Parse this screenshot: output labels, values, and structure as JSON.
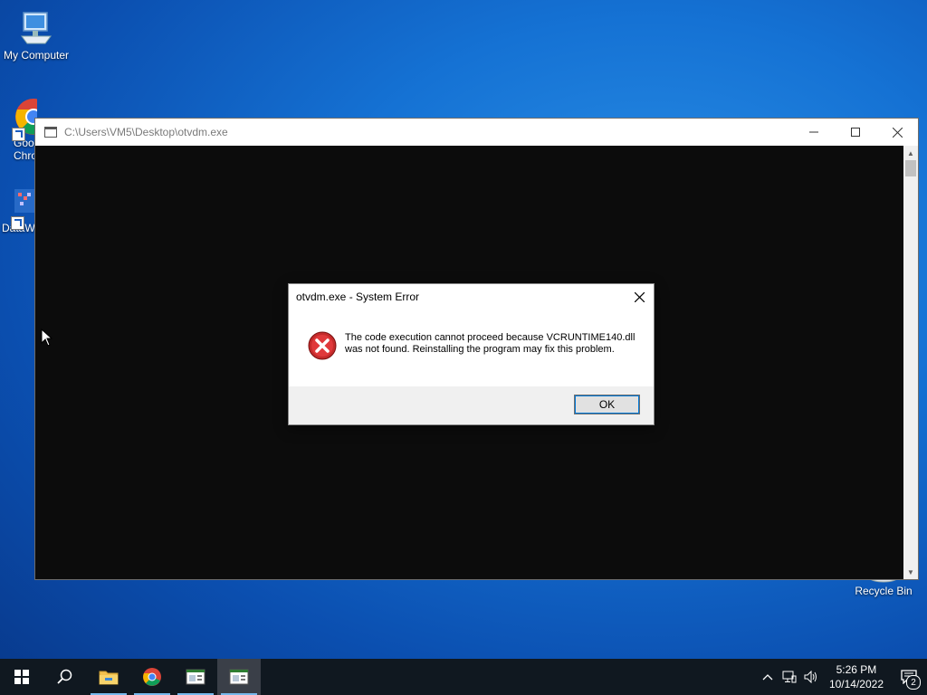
{
  "desktop": {
    "icons": [
      {
        "label": "My Computer"
      },
      {
        "label": "Google Chrome",
        "visible_label": "Goo\nChro"
      },
      {
        "label": "DataW"
      }
    ],
    "recycle_bin": "Recycle Bin"
  },
  "console": {
    "title": "C:\\Users\\VM5\\Desktop\\otvdm.exe",
    "minimize": "—",
    "maximize": "☐",
    "close": "✕"
  },
  "dialog": {
    "title": "otvdm.exe - System Error",
    "close": "✕",
    "message": "The code execution cannot proceed because VCRUNTIME140.dll was not found. Reinstalling the program may fix this problem.",
    "ok_label": "OK",
    "icon": "error-icon"
  },
  "taskbar": {
    "items": [
      "start",
      "search",
      "file-explorer",
      "chrome",
      "app-window",
      "app-window-active"
    ],
    "clock_time": "5:26 PM",
    "clock_date": "10/14/2022",
    "notification_count": "2"
  },
  "colors": {
    "desktop_blue": "#1572d4",
    "console_bg": "#0c0c0c",
    "error_red": "#d4272c",
    "taskbar": "#101820"
  }
}
